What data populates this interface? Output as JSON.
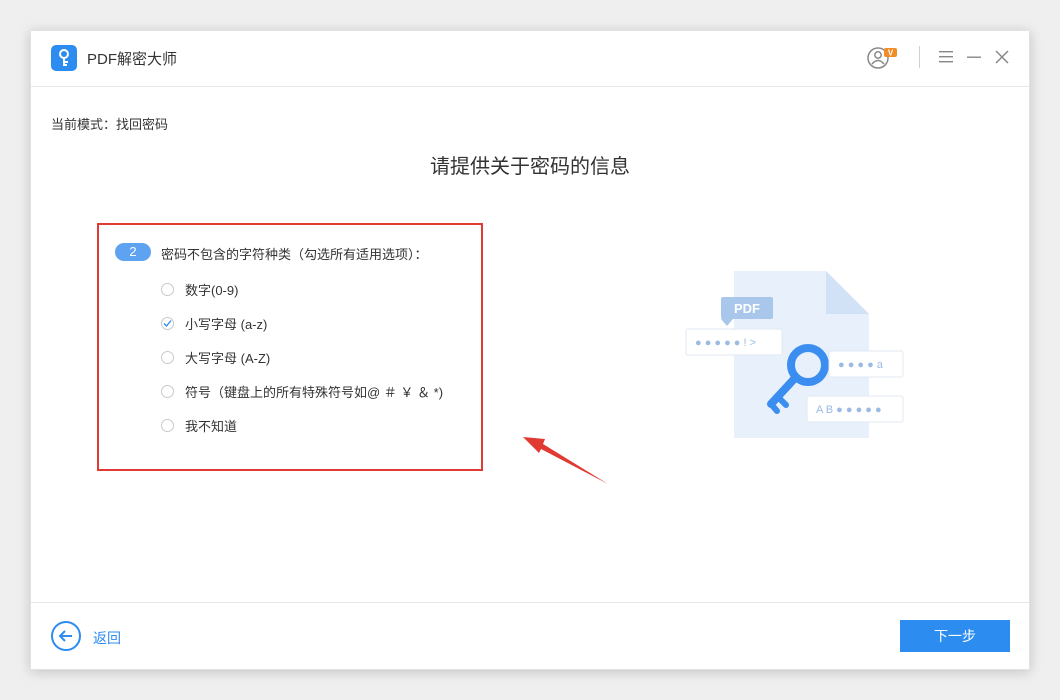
{
  "app": {
    "title": "PDF解密大师",
    "colors": {
      "accent": "#2d8cf0",
      "highlight": "#e03a32"
    }
  },
  "titlebar": {
    "icons": [
      "user-vip-icon",
      "menu-icon",
      "minimize-icon",
      "close-icon"
    ],
    "vip_badge": "V"
  },
  "mode": {
    "text": "当前模式：找回密码"
  },
  "heading": "请提供关于密码的信息",
  "question": {
    "number": "2",
    "text": "密码不包含的字符种类（勾选所有适用选项）：",
    "options": [
      {
        "label": "数字(0-9)",
        "checked": false
      },
      {
        "label": "小写字母 (a-z)",
        "checked": true
      },
      {
        "label": "大写字母 (A-Z)",
        "checked": false
      },
      {
        "label": "符号（键盘上的所有特殊符号如@ ＃ ￥ ＆ *)",
        "checked": false
      },
      {
        "label": "我不知道",
        "checked": false
      }
    ]
  },
  "illustration": {
    "pdf_tag": "PDF",
    "card1": "● ● ● ● ● ! >",
    "card2": "● ● ● ● a",
    "card3": "A B ● ● ● ● ●"
  },
  "footer": {
    "back_label": "返回",
    "next_label": "下一步"
  }
}
